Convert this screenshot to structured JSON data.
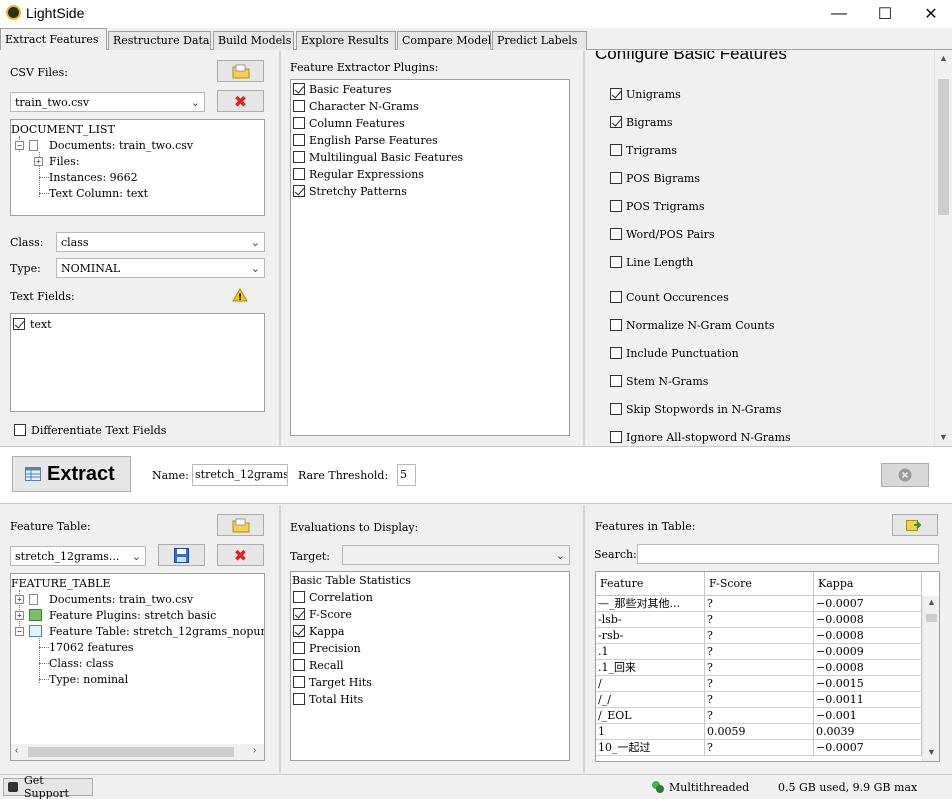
{
  "window": {
    "title": "LightSide",
    "minimize": "—",
    "maximize": "☐",
    "close": "✕"
  },
  "tabs": [
    "Extract Features",
    "Restructure Data",
    "Build Models",
    "Explore Results",
    "Compare Models",
    "Predict Labels"
  ],
  "csv": {
    "label": "CSV Files:",
    "selected": "train_two.csv",
    "tree": {
      "root": "DOCUMENT_LIST",
      "documents": "Documents: train_two.csv",
      "files": "Files:",
      "instances": "Instances: 9662",
      "text_column": "Text Column: text"
    },
    "class_label": "Class:",
    "class_value": "class",
    "type_label": "Type:",
    "type_value": "NOMINAL",
    "text_fields_label": "Text Fields:",
    "text_fields": [
      {
        "label": "text",
        "checked": true
      }
    ],
    "differentiate": {
      "label": "Differentiate Text Fields",
      "checked": false
    }
  },
  "plugins": {
    "label": "Feature Extractor Plugins:",
    "items": [
      {
        "label": "Basic Features",
        "checked": true
      },
      {
        "label": "Character N-Grams",
        "checked": false
      },
      {
        "label": "Column Features",
        "checked": false
      },
      {
        "label": "English Parse Features",
        "checked": false
      },
      {
        "label": "Multilingual Basic Features",
        "checked": false
      },
      {
        "label": "Regular Expressions",
        "checked": false
      },
      {
        "label": "Stretchy Patterns",
        "checked": true
      }
    ]
  },
  "configure": {
    "title": "Configure Basic Features",
    "group1": [
      {
        "label": "Unigrams",
        "checked": true
      },
      {
        "label": "Bigrams",
        "checked": true
      },
      {
        "label": "Trigrams",
        "checked": false
      },
      {
        "label": "POS Bigrams",
        "checked": false
      },
      {
        "label": "POS Trigrams",
        "checked": false
      },
      {
        "label": "Word/POS Pairs",
        "checked": false
      },
      {
        "label": "Line Length",
        "checked": false
      }
    ],
    "group2": [
      {
        "label": "Count Occurences",
        "checked": false
      },
      {
        "label": "Normalize N-Gram Counts",
        "checked": false
      },
      {
        "label": "Include Punctuation",
        "checked": false
      },
      {
        "label": "Stem N-Grams",
        "checked": false
      },
      {
        "label": "Skip Stopwords in N-Grams",
        "checked": false
      },
      {
        "label": "Ignore All-stopword N-Grams",
        "checked": false
      }
    ]
  },
  "extract": {
    "button": "Extract",
    "name_label": "Name:",
    "name_value": "stretch_12grams",
    "rare_label": "Rare Threshold:",
    "rare_value": "5"
  },
  "feature_table": {
    "label": "Feature Table:",
    "selected": "stretch_12grams...",
    "tree": {
      "root": "FEATURE_TABLE",
      "documents": "Documents: train_two.csv",
      "plugins": "Feature Plugins: stretch basic",
      "table": "Feature Table: stretch_12grams_nopun",
      "features": "17062 features",
      "class": "Class: class",
      "type": "Type: nominal"
    }
  },
  "evaluations": {
    "label": "Evaluations to Display:",
    "target_label": "Target:",
    "target_value": "",
    "group_header": "Basic Table Statistics",
    "items": [
      {
        "label": "Correlation",
        "checked": false
      },
      {
        "label": "F-Score",
        "checked": true
      },
      {
        "label": "Kappa",
        "checked": true
      },
      {
        "label": "Precision",
        "checked": false
      },
      {
        "label": "Recall",
        "checked": false
      },
      {
        "label": "Target Hits",
        "checked": false
      },
      {
        "label": "Total Hits",
        "checked": false
      }
    ]
  },
  "features_in_table": {
    "label": "Features in Table:",
    "search_label": "Search:",
    "search_value": "",
    "columns": [
      "Feature",
      "F-Score",
      "Kappa"
    ],
    "rows": [
      [
        "—_那些对其他...",
        "?",
        "−0.0007"
      ],
      [
        "-lsb-",
        "?",
        "−0.0008"
      ],
      [
        "-rsb-",
        "?",
        "−0.0008"
      ],
      [
        ".1",
        "?",
        "−0.0009"
      ],
      [
        ".1_回来",
        "?",
        "−0.0008"
      ],
      [
        "/",
        "?",
        "−0.0015"
      ],
      [
        "/_/",
        "?",
        "−0.0011"
      ],
      [
        "/_EOL",
        "?",
        "−0.001"
      ],
      [
        "1",
        "0.0059",
        "0.0039"
      ],
      [
        "10_一起过",
        "?",
        "−0.0007"
      ]
    ]
  },
  "status": {
    "support": "Get Support",
    "multithreaded": "Multithreaded",
    "memory": "0.5 GB used, 9.9 GB max"
  }
}
